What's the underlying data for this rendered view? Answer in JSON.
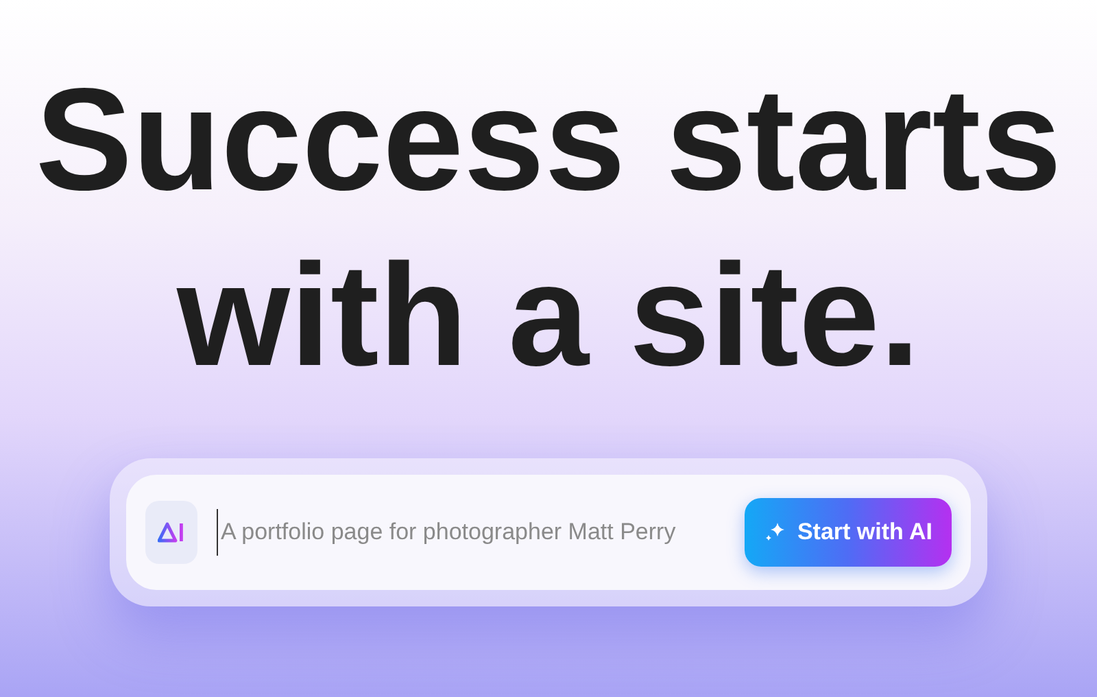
{
  "headline": [
    "Success starts",
    "with a site."
  ],
  "prompt": {
    "placeholder": "A portfolio page for photographer Matt Perry"
  },
  "button": {
    "label": "Start with AI"
  }
}
